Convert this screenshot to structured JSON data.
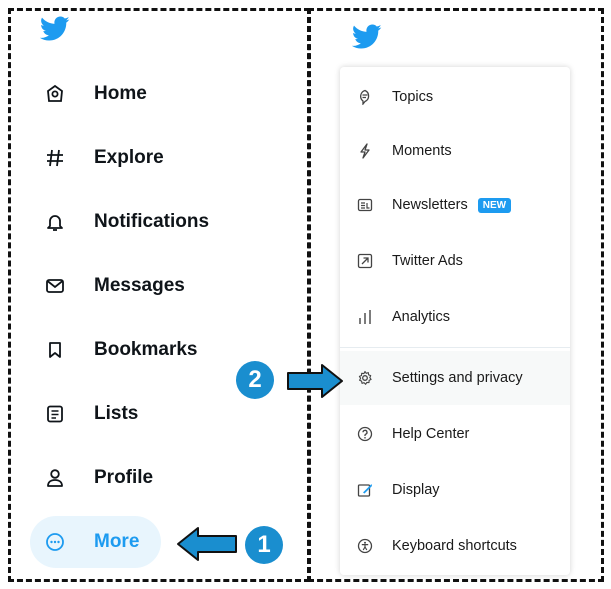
{
  "colors": {
    "accent": "#1d9bf0",
    "active_bg": "#e8f5fd",
    "step_badge": "#1a8ecf",
    "arrow_fill": "#1a8ecf",
    "text": "#0f1419"
  },
  "left_nav": {
    "items": [
      {
        "label": "Home",
        "icon": "home-icon"
      },
      {
        "label": "Explore",
        "icon": "hashtag-icon"
      },
      {
        "label": "Notifications",
        "icon": "bell-icon"
      },
      {
        "label": "Messages",
        "icon": "envelope-icon"
      },
      {
        "label": "Bookmarks",
        "icon": "bookmark-icon"
      },
      {
        "label": "Lists",
        "icon": "list-icon"
      },
      {
        "label": "Profile",
        "icon": "person-icon"
      },
      {
        "label": "More",
        "icon": "more-circle-icon",
        "active": true
      }
    ]
  },
  "more_menu": {
    "items": [
      {
        "label": "Topics",
        "icon": "topics-icon"
      },
      {
        "label": "Moments",
        "icon": "lightning-icon"
      },
      {
        "label": "Newsletters",
        "icon": "newsletter-icon",
        "badge": "NEW"
      },
      {
        "label": "Twitter Ads",
        "icon": "external-arrow-icon"
      },
      {
        "label": "Analytics",
        "icon": "bar-chart-icon"
      },
      {
        "label": "Settings and privacy",
        "icon": "gear-icon",
        "highlighted": true
      },
      {
        "label": "Help Center",
        "icon": "question-icon"
      },
      {
        "label": "Display",
        "icon": "display-icon"
      },
      {
        "label": "Keyboard shortcuts",
        "icon": "accessibility-icon"
      }
    ]
  },
  "steps": {
    "one": "1",
    "two": "2"
  }
}
